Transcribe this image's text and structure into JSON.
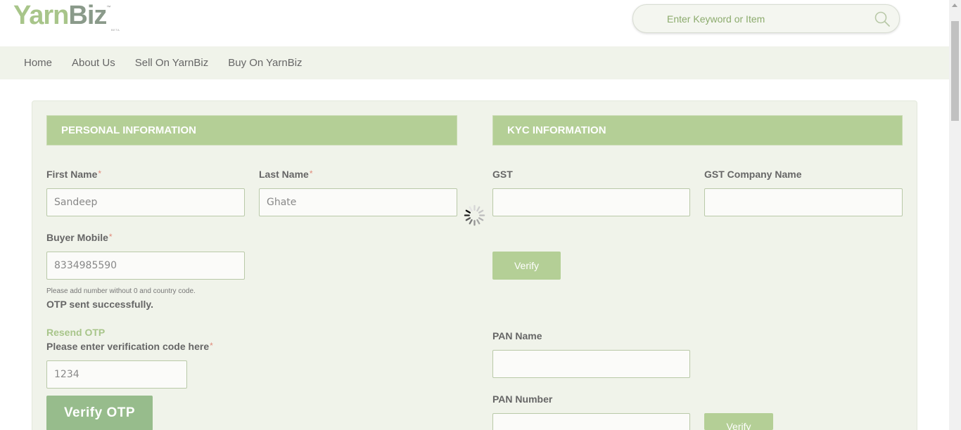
{
  "header": {
    "logo_part1": "Yarn",
    "logo_part2": "Biz",
    "logo_tm": "™",
    "logo_beta": "BETA",
    "search_placeholder": "Enter Keyword or Item"
  },
  "nav": {
    "items": [
      {
        "label": "Home"
      },
      {
        "label": "About Us"
      },
      {
        "label": "Sell On YarnBiz"
      },
      {
        "label": "Buy On YarnBiz"
      }
    ]
  },
  "personal": {
    "title": "PERSONAL INFORMATION",
    "first_name_label": "First Name",
    "first_name_value": "Sandeep",
    "last_name_label": "Last Name",
    "last_name_value": "Ghate",
    "mobile_label": "Buyer Mobile",
    "mobile_value": "8334985590",
    "mobile_hint": "Please add number without 0 and country code.",
    "otp_status": "OTP sent successfully.",
    "resend_otp": "Resend OTP",
    "code_label": "Please enter verification code here",
    "code_value": "1234",
    "verify_otp_button": "Verify OTP",
    "required_mark": "*"
  },
  "kyc": {
    "title": "KYC INFORMATION",
    "gst_label": "GST",
    "gst_value": "",
    "gst_company_label": "GST Company Name",
    "gst_company_value": "",
    "gst_verify_button": "Verify",
    "pan_name_label": "PAN Name",
    "pan_name_value": "",
    "pan_number_label": "PAN Number",
    "pan_number_value": "",
    "pan_verify_button": "Verify"
  },
  "colors": {
    "accent": "#b4cf96",
    "accent_dark": "#97bc8c",
    "panel_bg": "#f0f3ea",
    "required": "#e08a7a"
  }
}
